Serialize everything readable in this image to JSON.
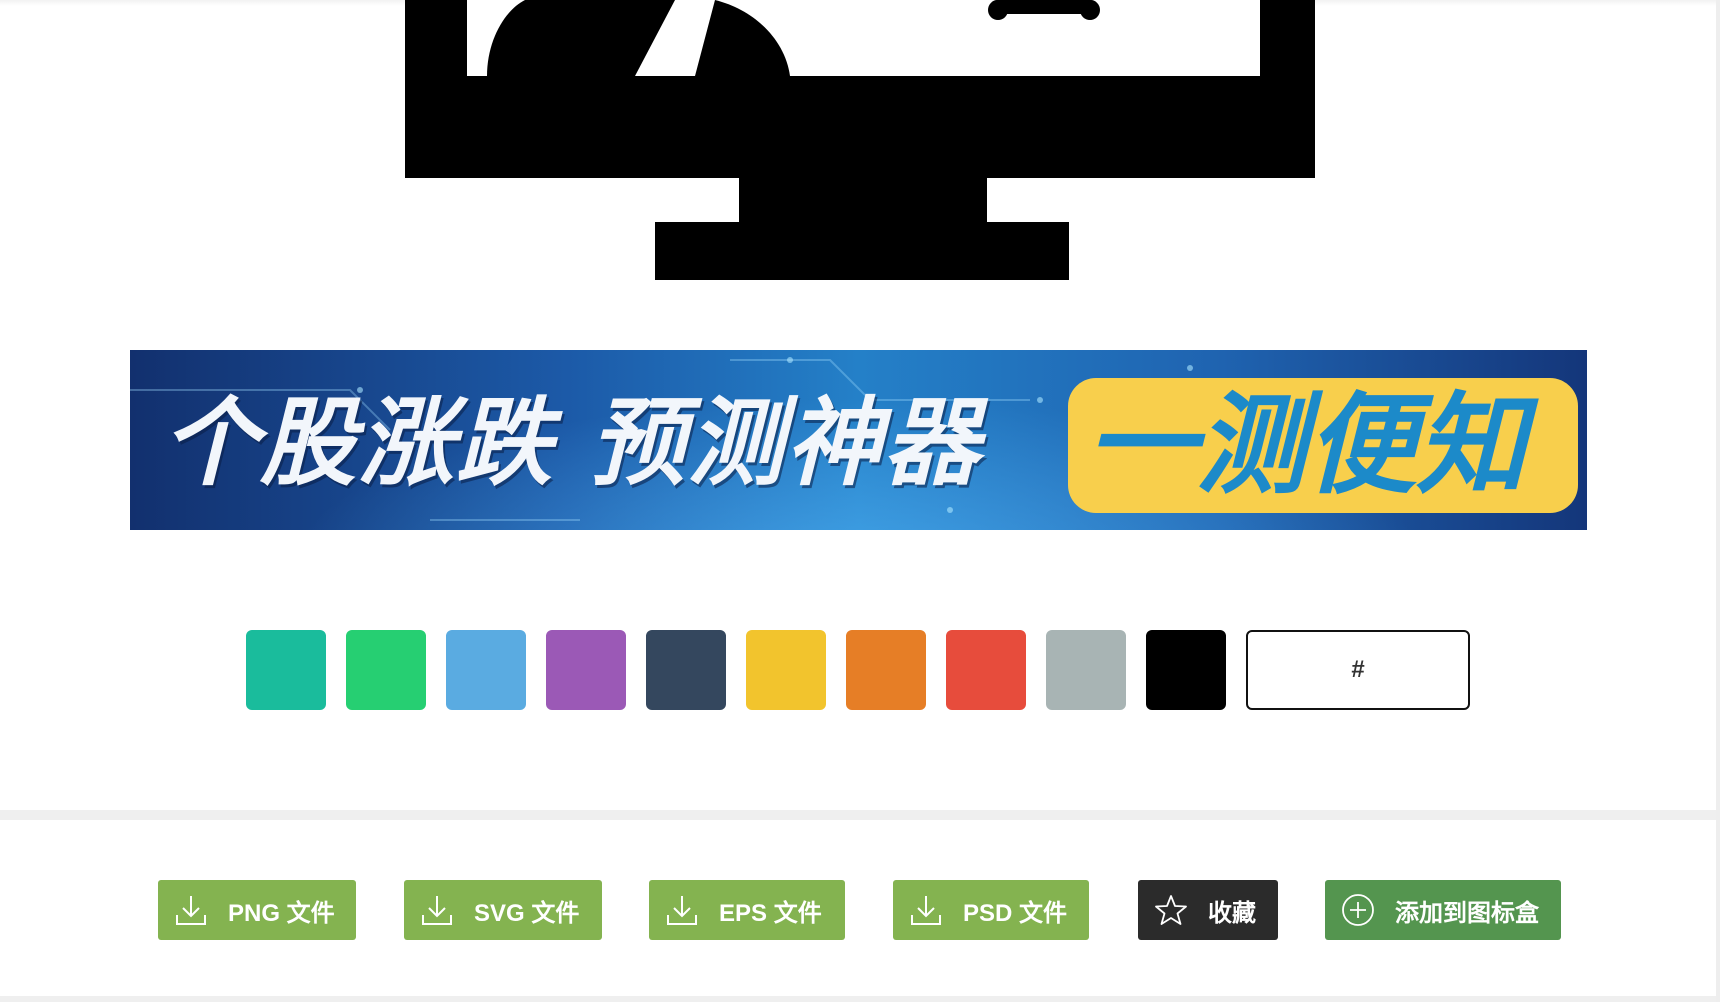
{
  "ad": {
    "left_text": "个股涨跌  预测神器",
    "right_text": "一测便知"
  },
  "colors": {
    "swatches": [
      "#1abc9c",
      "#26cf72",
      "#5aabe1",
      "#9b59b6",
      "#34475e",
      "#f2c42d",
      "#e67e26",
      "#e74c3c",
      "#a8b4b4",
      "#000000"
    ],
    "accent_green": "#84b350",
    "accent_darkgreen": "#54954f",
    "accent_dark": "#2b2b2b"
  },
  "color_input": {
    "placeholder": "#",
    "value": ""
  },
  "downloads": {
    "png_label": "PNG 文件",
    "svg_label": "SVG 文件",
    "eps_label": "EPS 文件",
    "psd_label": "PSD 文件",
    "favorite_label": "收藏",
    "add_to_box_label": "添加到图标盒"
  },
  "icons": {
    "download": "download-icon",
    "favorite": "star-icon",
    "add": "plus-circle-icon",
    "preview": "computer-user-icon"
  }
}
